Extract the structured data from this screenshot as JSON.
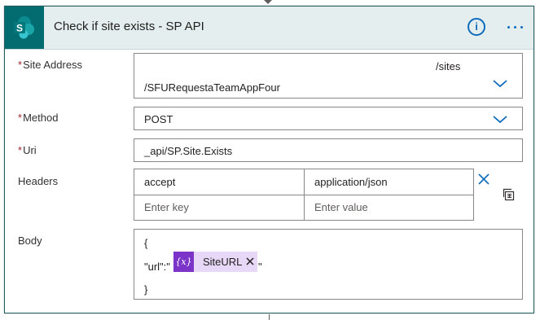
{
  "action": {
    "title": "Check if site exists - SP API",
    "icon": "sharepoint-icon",
    "info_glyph": "i"
  },
  "fields": {
    "site_address": {
      "label": "Site Address",
      "required_mark": "*",
      "value_line1": "/sites",
      "value_line2": "/SFURequestaTeamAppFour"
    },
    "method": {
      "label": "Method",
      "required_mark": "*",
      "value": "POST"
    },
    "uri": {
      "label": "Uri",
      "required_mark": "*",
      "value": "_api/SP.Site.Exists"
    },
    "headers": {
      "label": "Headers",
      "rows": [
        {
          "key": "accept",
          "value": "application/json"
        }
      ],
      "key_placeholder": "Enter key",
      "value_placeholder": "Enter value"
    },
    "body": {
      "label": "Body",
      "line1": "{",
      "line2_prefix": "\"url\":\"",
      "token_icon": "{x}",
      "token_label": "SiteURL",
      "line2_suffix": "\"",
      "line3": "}"
    }
  },
  "colors": {
    "accent": "#0f6cbd",
    "header_bg": "#e4eeee",
    "sharepoint": "#036c70",
    "required": "#a4262c",
    "token_bg": "#e8d8f8",
    "token_icon_bg": "#7b33c8"
  }
}
